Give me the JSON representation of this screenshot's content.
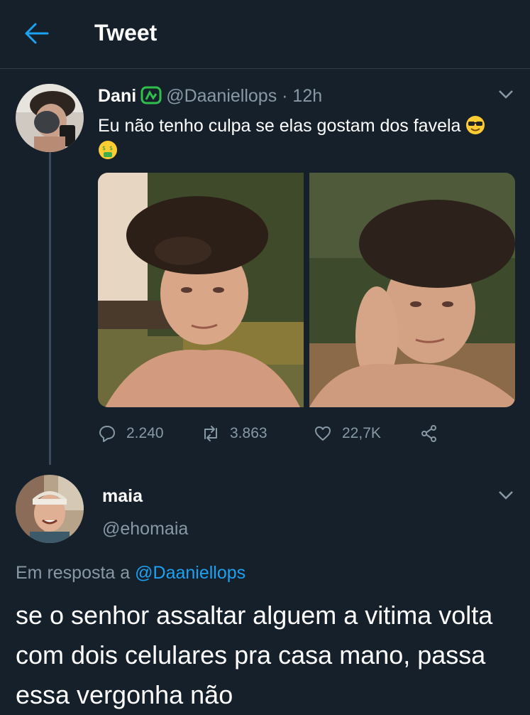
{
  "header": {
    "title": "Tweet",
    "back_icon": "arrow-left-icon",
    "accent": "#1da1f2"
  },
  "tweet": {
    "author_name": "Dani",
    "verified_icon": "green-emblem-icon",
    "handle_time": "@Daaniellops · 12h",
    "text": "Eu não tenho culpa se elas gostam dos favela",
    "emojis": [
      "sunglasses-emoji-icon",
      "money-mouth-emoji-icon"
    ],
    "images": [
      "selfie-photo-1",
      "selfie-photo-2"
    ],
    "replies": "2.240",
    "retweets": "3.863",
    "likes": "22,7K"
  },
  "reply": {
    "author_name": "maia",
    "handle": "@ehomaia",
    "in_reply_prefix": "Em resposta a",
    "in_reply_handle": "@Daaniellops",
    "text": "se o senhor assaltar alguem a vitima volta com dois celulares pra casa mano, passa essa vergonha não"
  }
}
